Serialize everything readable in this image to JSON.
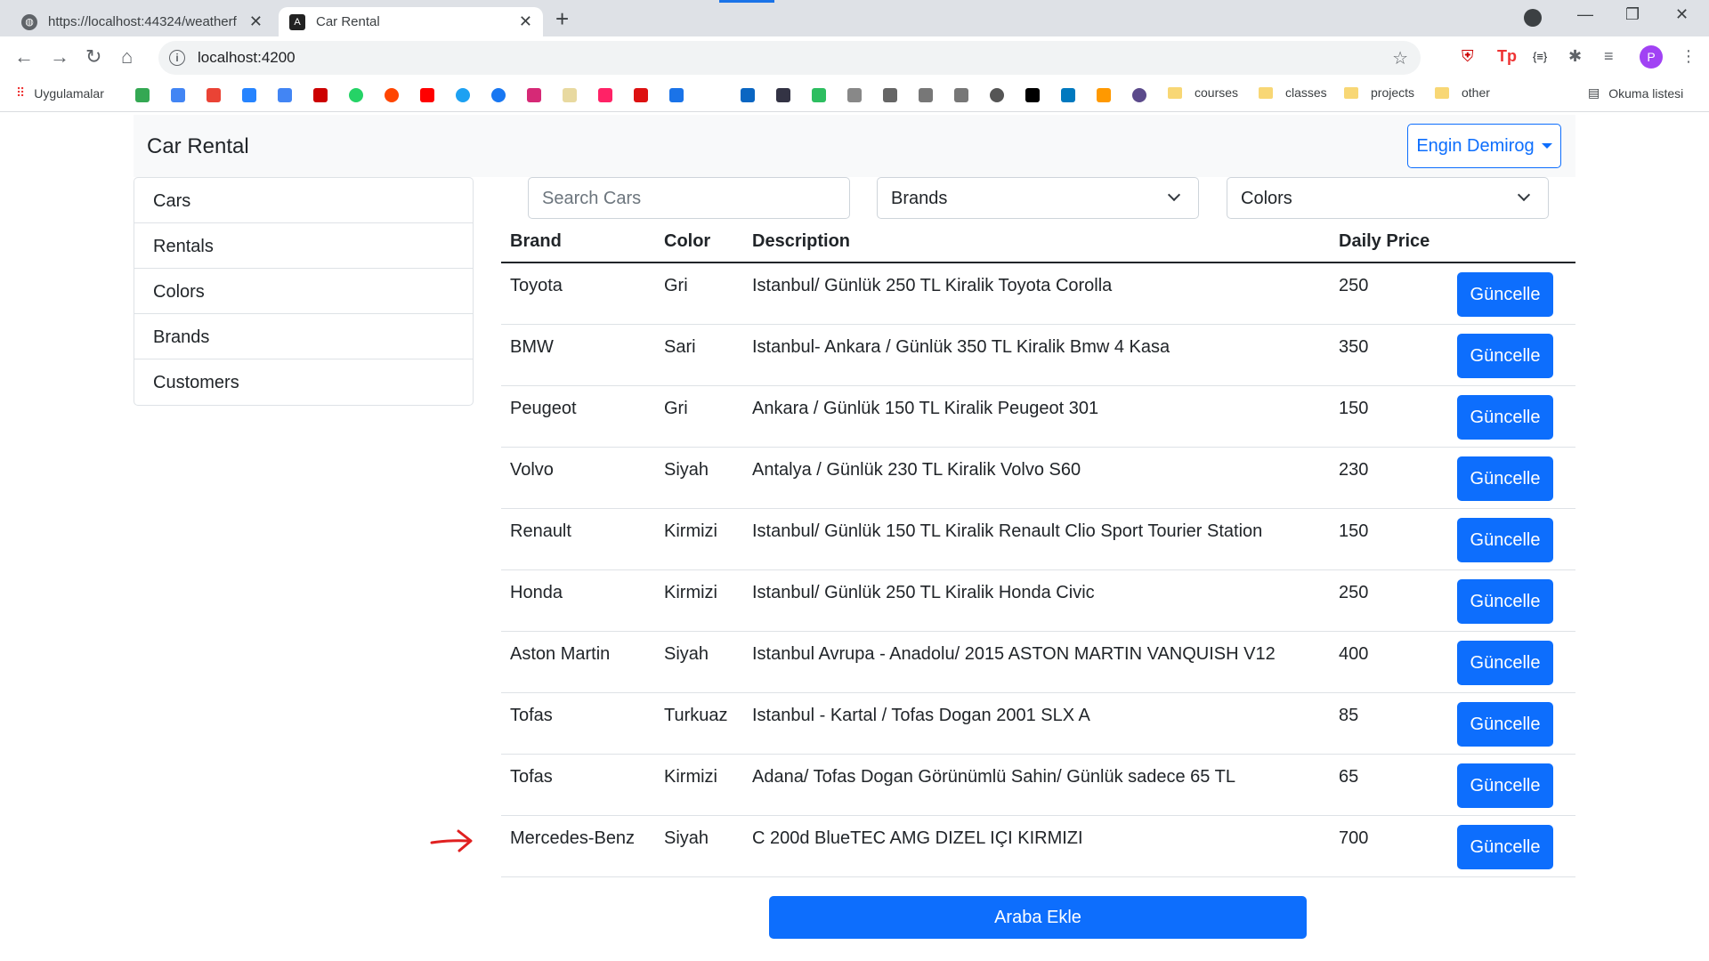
{
  "browser": {
    "tabs": [
      {
        "title": "https://localhost:44324/weatherf"
      },
      {
        "title": "Car Rental"
      }
    ],
    "address": "localhost:4200",
    "bookmarks": {
      "apps_label": "Uygulamalar",
      "folders": [
        "courses",
        "classes",
        "projects",
        "other"
      ],
      "reading_list": "Okuma listesi"
    },
    "profile_initial": "P"
  },
  "app": {
    "brand": "Car Rental",
    "user_button": "Engin Demirog",
    "sidebar": [
      "Cars",
      "Rentals",
      "Colors",
      "Brands",
      "Customers"
    ],
    "filters": {
      "search_placeholder": "Search Cars",
      "brands": "Brands",
      "colors": "Colors"
    },
    "table": {
      "headers": {
        "brand": "Brand",
        "color": "Color",
        "description": "Description",
        "price": "Daily Price"
      },
      "update_label": "Güncelle",
      "rows": [
        {
          "brand": "Toyota",
          "color": "Gri",
          "description": "Istanbul/ Günlük 250 TL Kiralik Toyota Corolla",
          "price": "250"
        },
        {
          "brand": "BMW",
          "color": "Sari",
          "description": "Istanbul- Ankara / Günlük 350 TL Kiralik Bmw 4 Kasa",
          "price": "350"
        },
        {
          "brand": "Peugeot",
          "color": "Gri",
          "description": "Ankara / Günlük 150 TL Kiralik Peugeot 301",
          "price": "150"
        },
        {
          "brand": "Volvo",
          "color": "Siyah",
          "description": "Antalya / Günlük 230 TL Kiralik Volvo S60",
          "price": "230"
        },
        {
          "brand": "Renault",
          "color": "Kirmizi",
          "description": "Istanbul/ Günlük 150 TL Kiralik Renault Clio Sport Tourier Station",
          "price": "150"
        },
        {
          "brand": "Honda",
          "color": "Kirmizi",
          "description": "Istanbul/ Günlük 250 TL Kiralik Honda Civic",
          "price": "250"
        },
        {
          "brand": "Aston Martin",
          "color": "Siyah",
          "description": "Istanbul Avrupa - Anadolu/ 2015 ASTON MARTIN VANQUISH V12",
          "price": "400"
        },
        {
          "brand": "Tofas",
          "color": "Turkuaz",
          "description": "Istanbul - Kartal / Tofas Dogan 2001 SLX A",
          "price": "85"
        },
        {
          "brand": "Tofas",
          "color": "Kirmizi",
          "description": "Adana/ Tofas Dogan Görünümlü Sahin/ Günlük sadece 65 TL",
          "price": "65"
        },
        {
          "brand": "Mercedes-Benz",
          "color": "Siyah",
          "description": "C 200d BlueTEC AMG DIZEL IÇI KIRMIZI",
          "price": "700"
        }
      ]
    },
    "add_button": "Araba Ekle"
  },
  "colors": {
    "primary": "#0d6efd",
    "annotation_arrow": "#e02020"
  }
}
